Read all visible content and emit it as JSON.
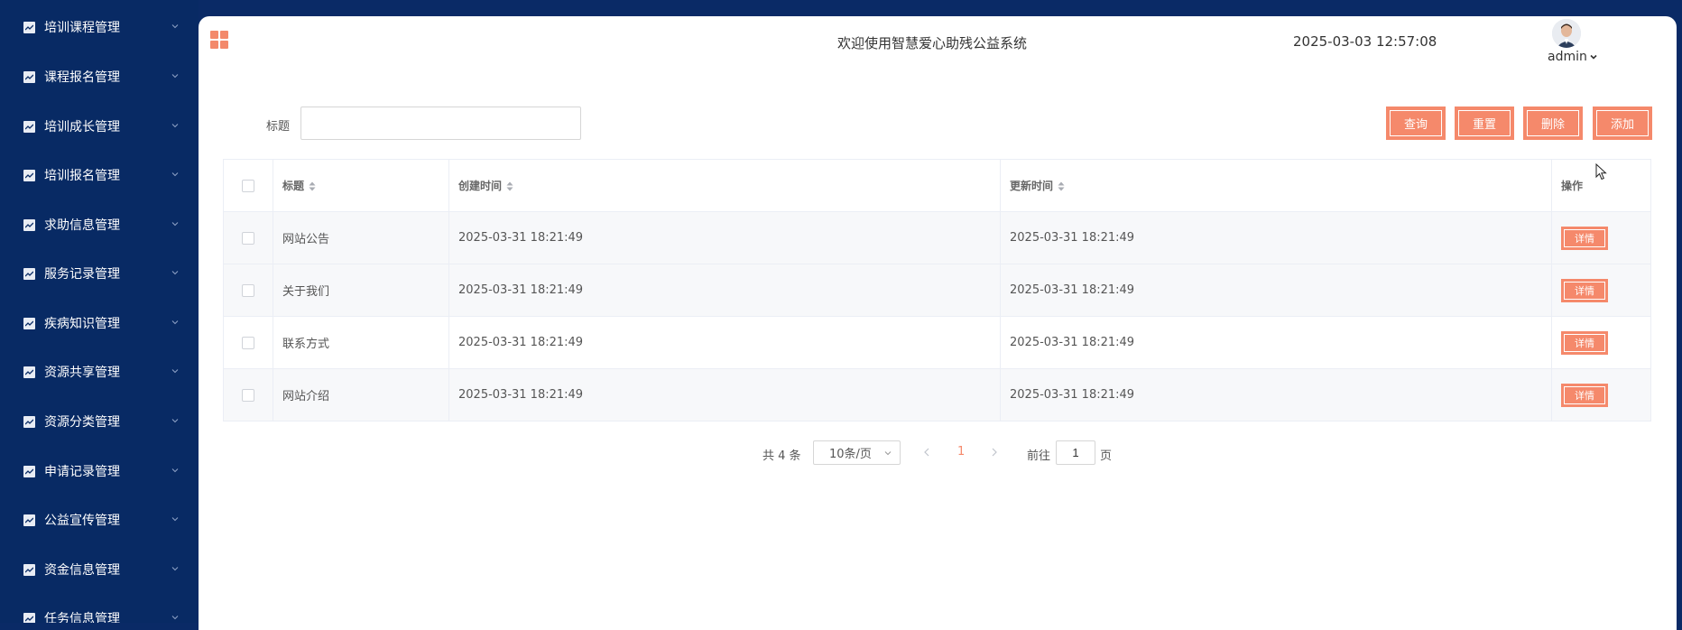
{
  "sidebar": {
    "items": [
      {
        "label": "培训课程管理"
      },
      {
        "label": "课程报名管理"
      },
      {
        "label": "培训成长管理"
      },
      {
        "label": "培训报名管理"
      },
      {
        "label": "求助信息管理"
      },
      {
        "label": "服务记录管理"
      },
      {
        "label": "疾病知识管理"
      },
      {
        "label": "资源共享管理"
      },
      {
        "label": "资源分类管理"
      },
      {
        "label": "申请记录管理"
      },
      {
        "label": "公益宣传管理"
      },
      {
        "label": "资金信息管理"
      },
      {
        "label": "任务信息管理"
      }
    ]
  },
  "header": {
    "welcome": "欢迎使用智慧爱心助残公益系统",
    "datetime": "2025-03-03 12:57:08",
    "username": "admin"
  },
  "search": {
    "label": "标题",
    "value": "",
    "placeholder": ""
  },
  "toolbar": {
    "query_label": "查询",
    "reset_label": "重置",
    "delete_label": "删除",
    "add_label": "添加"
  },
  "table": {
    "columns": {
      "title": "标题",
      "created": "创建时间",
      "updated": "更新时间",
      "actions": "操作"
    },
    "rows": [
      {
        "title": "网站公告",
        "created": "2025-03-31 18:21:49",
        "updated": "2025-03-31 18:21:49",
        "action": "详情"
      },
      {
        "title": "关于我们",
        "created": "2025-03-31 18:21:49",
        "updated": "2025-03-31 18:21:49",
        "action": "详情"
      },
      {
        "title": "联系方式",
        "created": "2025-03-31 18:21:49",
        "updated": "2025-03-31 18:21:49",
        "action": "详情"
      },
      {
        "title": "网站介绍",
        "created": "2025-03-31 18:21:49",
        "updated": "2025-03-31 18:21:49",
        "action": "详情"
      }
    ]
  },
  "pagination": {
    "total": "共 4 条",
    "page_size": "10条/页",
    "current_page": "1",
    "goto_label": "前往",
    "goto_value": "1",
    "page_suffix": "页"
  },
  "colors": {
    "sidebar_bg": "#082a64",
    "accent": "#f5896b"
  },
  "icons": {
    "sidebar_item": "chart-icon",
    "sidebar_chevron": "chevron-down-icon",
    "menu_toggle": "grid-icon",
    "user_menu": "caret-down-icon",
    "sort": "sort-icon"
  }
}
